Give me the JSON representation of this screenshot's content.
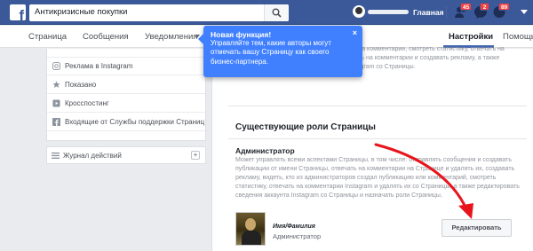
{
  "topbar": {
    "logo": "f",
    "search_value": "Антикризисные покупки",
    "home_label": "Главная",
    "badges": {
      "friends": "45",
      "messages": "2",
      "notifications": "89"
    },
    "colors": {
      "bar": "#3b5998",
      "badge": "#fa3e3e"
    }
  },
  "tabs": [
    {
      "label": "Страница"
    },
    {
      "label": "Сообщения"
    },
    {
      "label": "Уведомления"
    },
    {
      "label": "Настройки"
    },
    {
      "label": "Помощь"
    }
  ],
  "left_menu": {
    "items": [
      {
        "label": "Реклама в Instagram",
        "icon": "instagram-icon"
      },
      {
        "label": "Показано",
        "icon": "star-icon"
      },
      {
        "label": "Кросспостинг",
        "icon": "crosspost-icon"
      },
      {
        "label": "Входящие от Службы поддержки Страниц",
        "icon": "facebook-icon"
      }
    ],
    "activity_log": {
      "label": "Журнал действий",
      "icon": "list-icon"
    }
  },
  "main": {
    "top_text": "публикации от имени Страницы, отвечать на комментарии, смотреть статистику, отвечать на комментарии, смотреть статистику, отвечать на комментарии и создавать рекламу, а также редактировать информацию аккаунта Instagram со Страницы.",
    "roles_title": "Существующие роли Страницы",
    "admin_title": "Администратор",
    "admin_desc": "Может управлять всеми аспектами Страницы, в том числе: отправлять сообщения и создавать публикации от имени Страницы, отвечать на комментарии на Странице и удалять их, создавать рекламу, видеть, кто из администраторов создал публикацию или комментарий, смотреть статистику, отвечать на комментарии Instagram и удалять их со Страницы, а также редактировать сведения аккаунта Instagram со Страницы и назначать роли Страницы.",
    "person_name": "Имя/Фамилия",
    "person_role": "Администратор",
    "edit_label": "Редактировать"
  },
  "tooltip": {
    "title": "Новая функция!",
    "body": "Управляйте тем, какие авторы могут отмечать вашу Страницу как своего бизнес-партнера.",
    "close": "×",
    "color": "#4080ff"
  }
}
